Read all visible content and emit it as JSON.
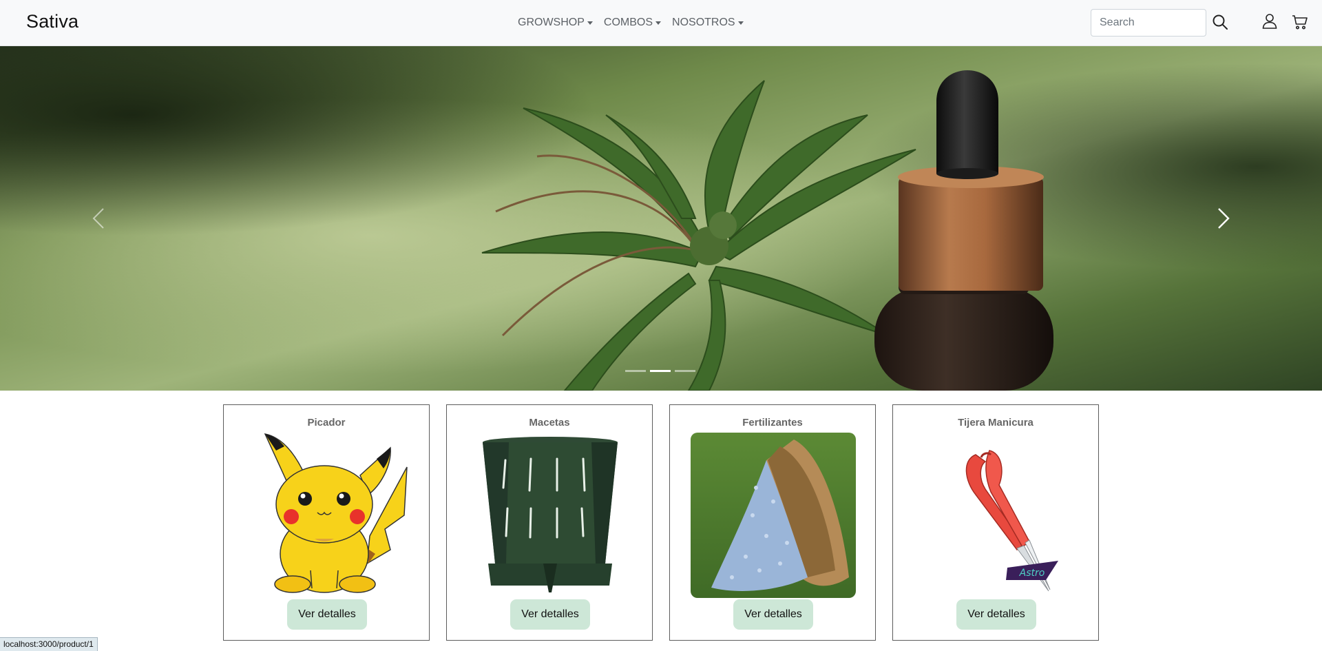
{
  "navbar": {
    "brand": "Sativa",
    "menu": [
      {
        "label": "GROWSHOP"
      },
      {
        "label": "COMBOS"
      },
      {
        "label": "NOSOTROS"
      }
    ],
    "search": {
      "placeholder": "Search",
      "value": ""
    },
    "icons": [
      "search-icon",
      "user-icon",
      "cart-icon"
    ]
  },
  "carousel": {
    "slide_count": 3,
    "active_index": 1,
    "controls": [
      "chevron-left-icon",
      "chevron-right-icon"
    ]
  },
  "products": [
    {
      "title": "Picador",
      "button": "Ver detalles"
    },
    {
      "title": "Macetas",
      "button": "Ver detalles"
    },
    {
      "title": "Fertilizantes",
      "button": "Ver detalles"
    },
    {
      "title": "Tijera Manicura",
      "button": "Ver detalles"
    }
  ],
  "status_bar": {
    "url": "localhost:3000/product/1"
  },
  "colors": {
    "navbar_bg": "#f8f9fa",
    "button_bg": "#cde7d7",
    "card_border": "#5b5b5b"
  }
}
